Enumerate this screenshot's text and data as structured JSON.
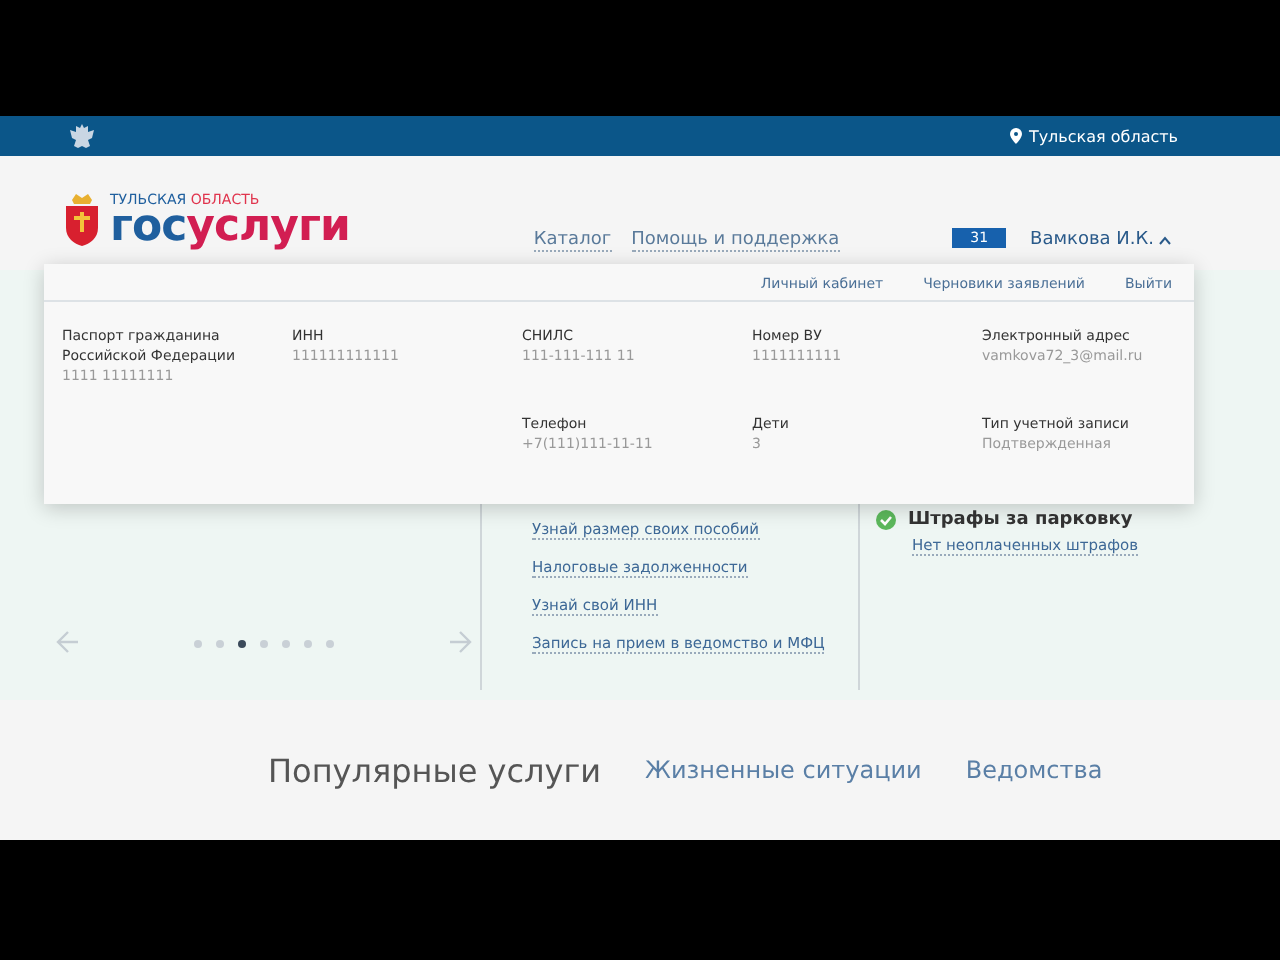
{
  "top_bar": {
    "region": "Тульская область"
  },
  "header": {
    "logo": {
      "caption": [
        "ТУЛЬСКАЯ",
        "ОБЛАСТЬ"
      ],
      "wordmark": [
        "гос",
        "услуги"
      ]
    },
    "nav": [
      "Каталог",
      "Помощь и поддержка"
    ],
    "notifications": "31",
    "user": {
      "name": "Вамкова И.К.",
      "expanded": true
    }
  },
  "profile_panel": {
    "links": [
      "Личный кабинет",
      "Черновики заявлений",
      "Выйти"
    ],
    "rows": [
      [
        {
          "label": "Паспорт гражданина Российской Федерации",
          "value": "1111 11111111"
        },
        {
          "label": "ИНН",
          "value": "111111111111"
        },
        {
          "label": "СНИЛС",
          "value": "111-111-111 11"
        },
        {
          "label": "Номер ВУ",
          "value": "1111111111"
        },
        {
          "label": "Электронный адрес",
          "value": "vamkova72_3@mail.ru"
        }
      ],
      [
        null,
        null,
        {
          "label": "Телефон",
          "value": "+7(111)111-11-11"
        },
        {
          "label": "Дети",
          "value": "3"
        },
        {
          "label": "Тип учетной записи",
          "value": "Подтвержденная"
        }
      ]
    ]
  },
  "services": {
    "carousel": {
      "dots": [
        {
          "selected": false
        },
        {
          "selected": false
        },
        {
          "selected": true
        },
        {
          "selected": false
        },
        {
          "selected": false
        },
        {
          "selected": false
        },
        {
          "selected": false
        }
      ]
    },
    "links": [
      "Узнай размер своих пособий",
      "Налоговые задолженности",
      "Узнай свой ИНН",
      "Запись на прием в ведомство и МФЦ"
    ],
    "fines": {
      "title": "Штрафы за парковку",
      "status": "Нет неоплаченных штрафов",
      "ok": true
    }
  },
  "tabs": [
    {
      "label": "Популярные услуги",
      "selected": true
    },
    {
      "label": "Жизненные ситуации",
      "selected": false
    },
    {
      "label": "Ведомства",
      "selected": false
    }
  ]
}
